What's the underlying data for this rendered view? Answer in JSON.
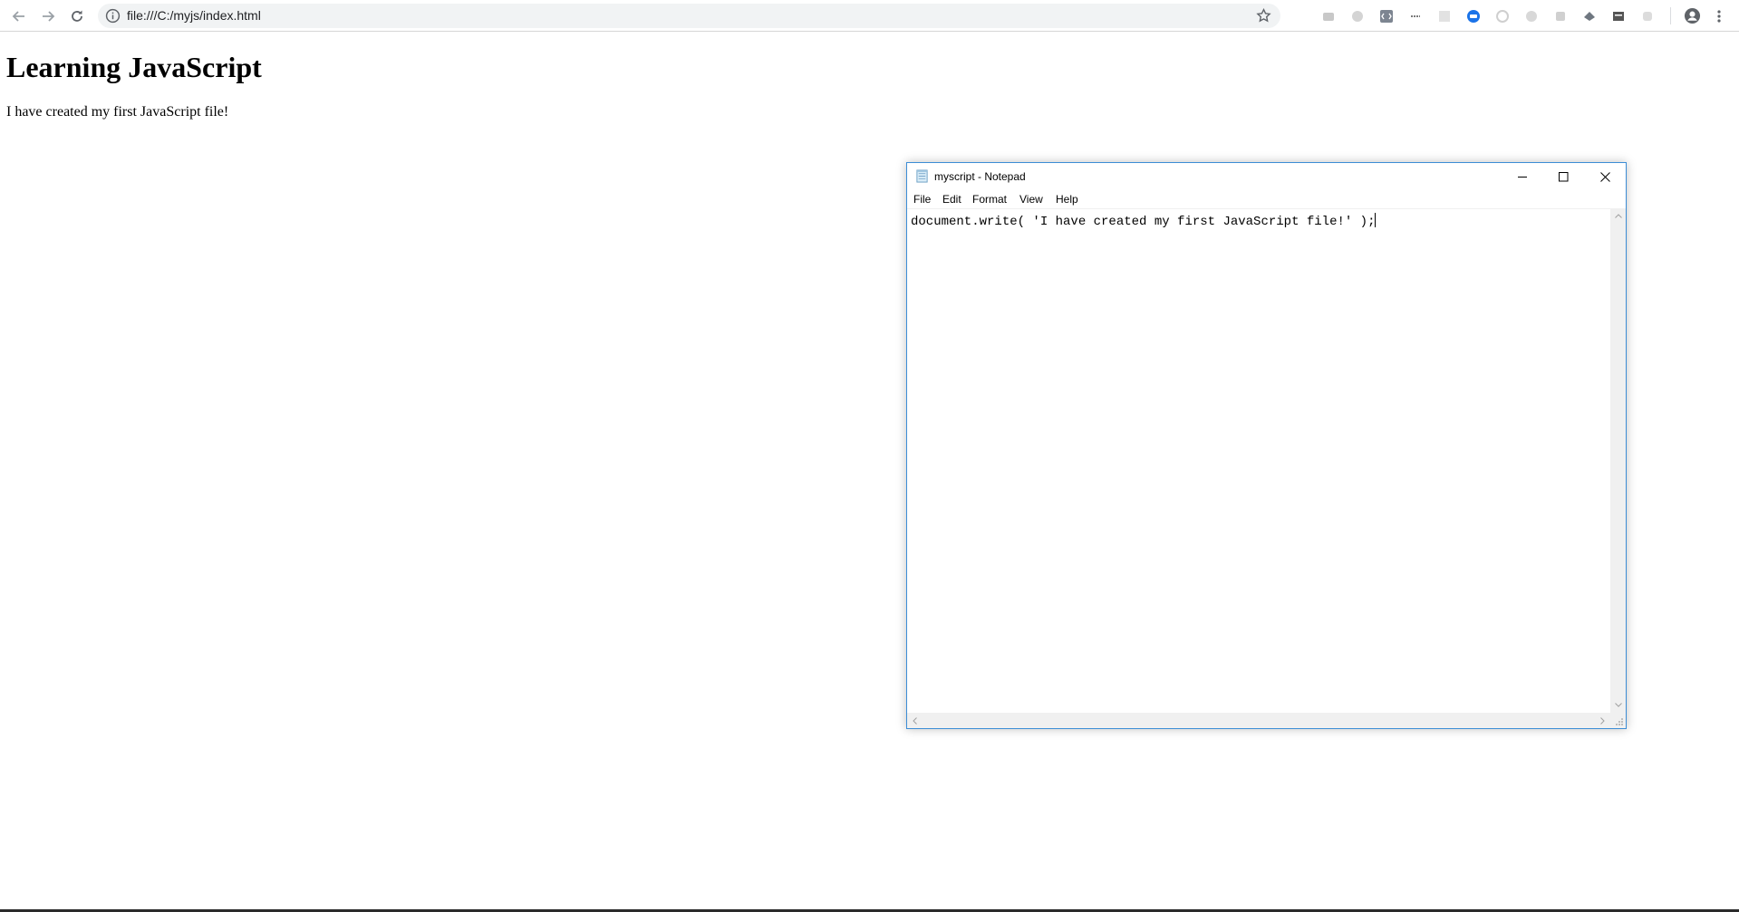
{
  "browser": {
    "url": "file:///C:/myjs/index.html",
    "icons": {
      "back": "arrow-left-icon",
      "forward": "arrow-right-icon",
      "reload": "reload-icon",
      "site_info": "info-icon",
      "bookmark": "star-icon",
      "profile": "account-icon",
      "menu": "kebab-menu-icon"
    },
    "extensions": [
      "extension-icon",
      "extension-icon",
      "code-extension-icon",
      "extension-icon",
      "extension-icon",
      "extension-icon",
      "extension-icon",
      "extension-icon",
      "extension-icon",
      "extension-icon",
      "extension-icon",
      "extension-icon"
    ]
  },
  "page": {
    "heading": "Learning JavaScript",
    "paragraph": "I have created my first JavaScript file!"
  },
  "notepad": {
    "title": "myscript - Notepad",
    "menu": [
      "File",
      "Edit",
      "Format",
      "View",
      "Help"
    ],
    "content": "document.write( 'I have created my first JavaScript file!' );",
    "accent_color": "#3c8dd6"
  }
}
